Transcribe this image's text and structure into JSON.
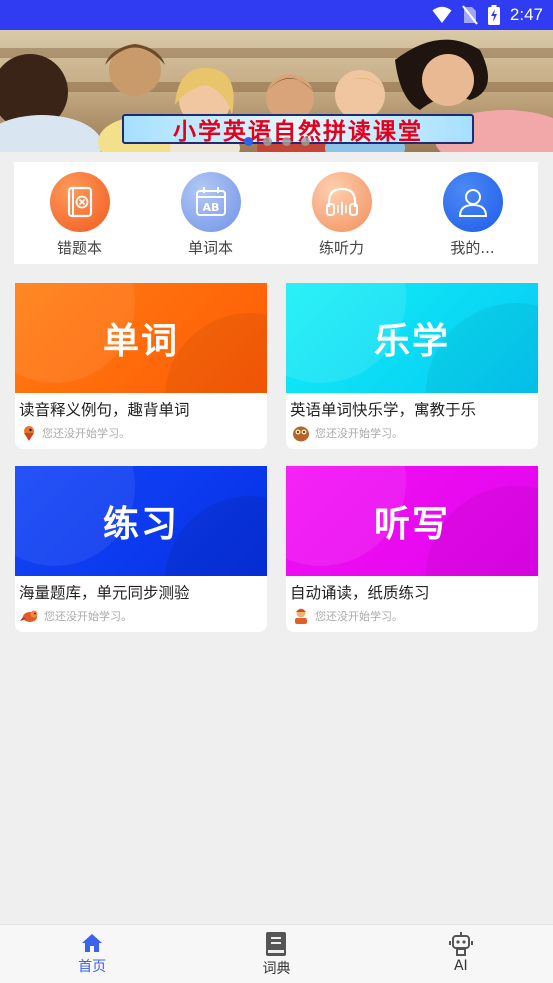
{
  "status_bar": {
    "time": "2:47",
    "icons": [
      "wifi-icon",
      "no-sim-icon",
      "battery-charging-icon"
    ]
  },
  "banner": {
    "title": "小学英语自然拼读课堂",
    "page_count": 4,
    "active_page": 1
  },
  "quick_actions": [
    {
      "label": "错题本",
      "icon": "mistake-book-icon",
      "color": "#f16a2c"
    },
    {
      "label": "单词本",
      "icon": "word-book-icon",
      "color": "#86a8ee"
    },
    {
      "label": "练听力",
      "icon": "headphones-icon",
      "color": "#f5a57c"
    },
    {
      "label": "我的...",
      "icon": "user-icon",
      "color": "#2d6ff0"
    }
  ],
  "cards": [
    {
      "title": "单词",
      "desc": "读音释义例句，趣背单词",
      "status": "您还没开始学习。",
      "color": "#ff6a0a",
      "avatar": "bird-avatar-icon"
    },
    {
      "title": "乐学",
      "desc": "英语单词快乐学，寓教于乐",
      "status": "您还没开始学习。",
      "color": "#0ad8f5",
      "avatar": "owl-avatar-icon"
    },
    {
      "title": "练习",
      "desc": "海量题库，单元同步测验",
      "status": "您还没开始学习。",
      "color": "#0a3cf2",
      "avatar": "bird-avatar-icon"
    },
    {
      "title": "听写",
      "desc": "自动诵读，纸质练习",
      "status": "您还没开始学习。",
      "color": "#ef0af0",
      "avatar": "kid-avatar-icon"
    }
  ],
  "tabs": [
    {
      "label": "首页",
      "icon": "home-icon",
      "active": true
    },
    {
      "label": "词典",
      "icon": "dictionary-icon",
      "active": false
    },
    {
      "label": "AI",
      "icon": "robot-icon",
      "active": false
    }
  ]
}
